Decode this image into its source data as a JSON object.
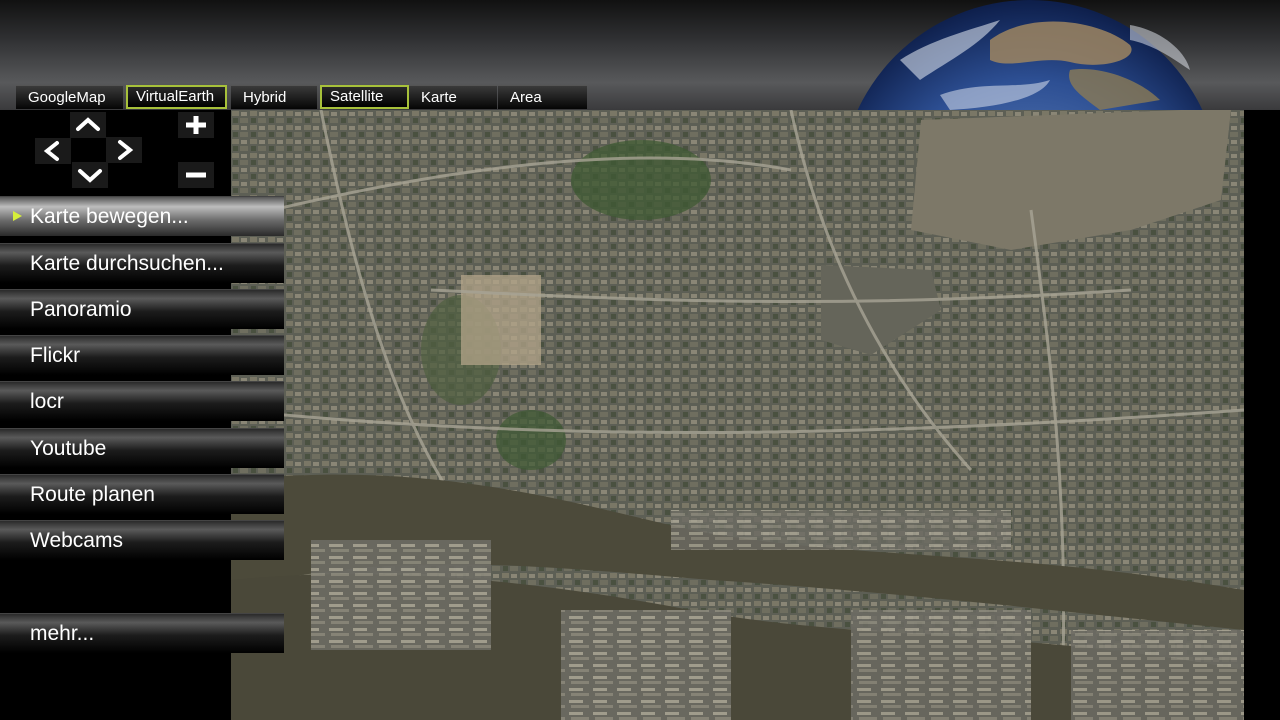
{
  "map_types": [
    {
      "label": "GoogleMap",
      "active": false
    },
    {
      "label": "VirtualEarth",
      "active": true
    },
    {
      "label": "Hybrid",
      "active": false
    },
    {
      "label": "Satellite",
      "active": true
    },
    {
      "label": "Karte",
      "active": false
    },
    {
      "label": "Area",
      "active": false
    }
  ],
  "nav_icons": {
    "up": "chevron-up-icon",
    "down": "chevron-down-icon",
    "left": "chevron-left-icon",
    "right": "chevron-right-icon",
    "zoom_in": "plus-icon",
    "zoom_out": "minus-icon"
  },
  "menu": [
    {
      "label": "Karte bewegen...",
      "active": true
    },
    {
      "label": "Karte durchsuchen...",
      "active": false
    },
    {
      "label": "Panoramio",
      "active": false
    },
    {
      "label": "Flickr",
      "active": false
    },
    {
      "label": "locr",
      "active": false
    },
    {
      "label": "Youtube",
      "active": false
    },
    {
      "label": "Route planen",
      "active": false
    },
    {
      "label": "Webcams",
      "active": false
    },
    {
      "label": "mehr...",
      "active": false
    }
  ],
  "colors": {
    "accent": "#a7c13a",
    "active_arrow": "#d6ef3a",
    "background": "#000000"
  }
}
